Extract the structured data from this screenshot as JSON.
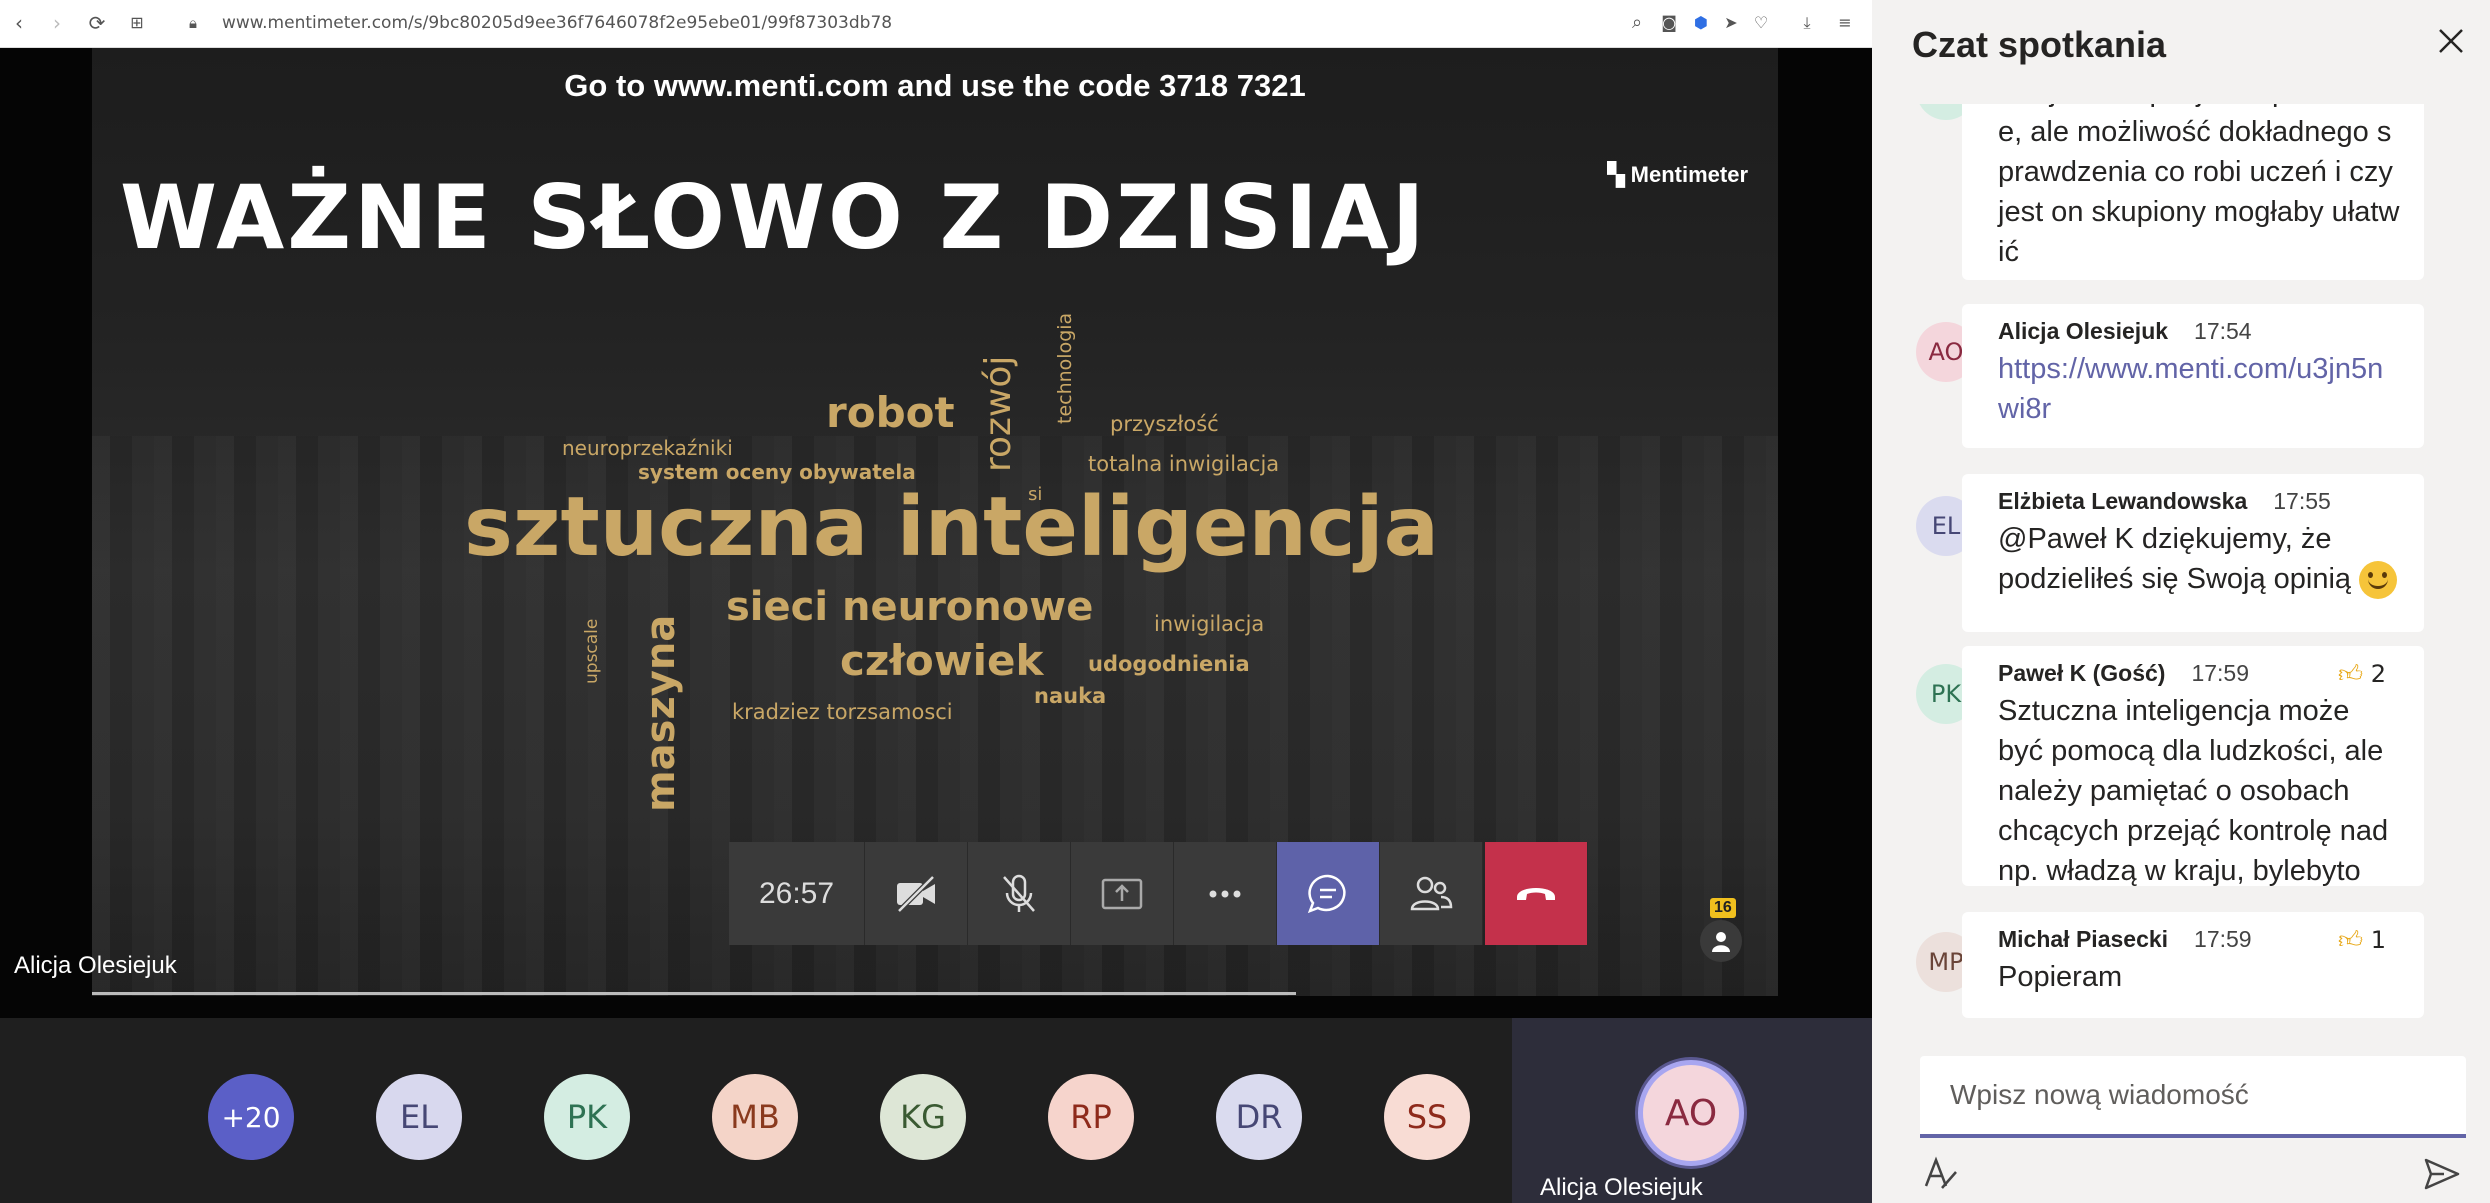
{
  "browser": {
    "url": "www.mentimeter.com/s/9bc80205d9ee36f7646078f2e95ebe01/99f87303db78"
  },
  "slide": {
    "banner_pre": "Go to ",
    "banner_site": "www.menti.com",
    "banner_mid": " and use the code ",
    "banner_code": "3718 7321",
    "title": "WAŻNE SŁOWO Z DZISIAJ",
    "logo": "Mentimeter",
    "words": {
      "w1": "sztuczna inteligencja",
      "w2": "robot",
      "w3": "sieci neuronowe",
      "w4": "człowiek",
      "w5": "maszyna",
      "w6": "rozwój",
      "w7": "technologia",
      "w8": "przyszłość",
      "w9": "totalna inwigilacja",
      "w10": "neuroprzekaźniki",
      "w11": "system oceny obywatela",
      "w12": "si",
      "w13": "inwigilacja",
      "w14": "udogodnienia",
      "w15": "nauka",
      "w16": "kradziez torzsamosci",
      "w17": "upscale"
    }
  },
  "presenter": {
    "name": "Alicja Olesiejuk"
  },
  "controls": {
    "timer": "26:57",
    "participants_count": "16"
  },
  "strip": {
    "p0": "+20",
    "p1": "EL",
    "p2": "PK",
    "p3": "MB",
    "p4": "KG",
    "p5": "RP",
    "p6": "DR",
    "p7": "SS",
    "self_initials": "AO",
    "self_name": "Alicja Olesiejuk"
  },
  "chat": {
    "title": "Czat spotkania",
    "messages": [
      {
        "initials": "",
        "author": "",
        "time": "",
        "body": "Nie jest to specjalnie potrzebne, ale możliwość dokładnego sprawdzenia co robi uczeń i czy jest on skupiony mogłaby ułatwić"
      },
      {
        "initials": "AO",
        "author": "Alicja Olesiejuk",
        "time": "17:54",
        "body": "https://www.menti.com/u3jn5nwi8r"
      },
      {
        "initials": "EL",
        "author": "Elżbieta Lewandowska",
        "time": "17:55",
        "body": "@Paweł K dziękujemy, że podzieliłeś się Swoją opinią"
      },
      {
        "initials": "PK",
        "author": "Paweł K (Gość)",
        "time": "17:59",
        "reaction": "2",
        "body": "Sztuczna inteligencja może być pomocą dla ludzkości, ale należy pamiętać o osobach chcących przejąć kontrolę nad np. władzą w kraju, bylebyto"
      },
      {
        "initials": "MP",
        "author": "Michał Piasecki",
        "time": "17:59",
        "reaction": "1",
        "body": "Popieram"
      }
    ],
    "compose_placeholder": "Wpisz nową wiadomość"
  },
  "colors": {
    "accent": "#6264a7",
    "hangup": "#c4314b",
    "word_gold": "#c9a766"
  }
}
